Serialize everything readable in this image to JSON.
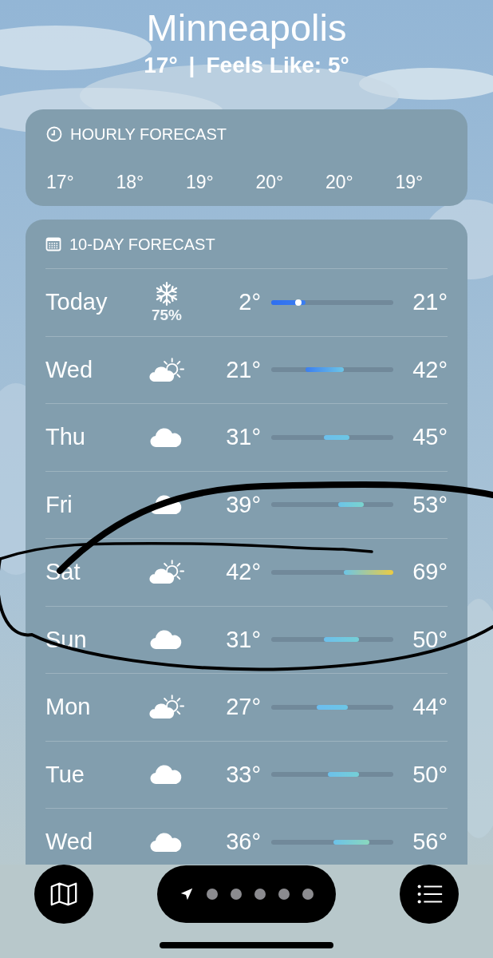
{
  "location": {
    "city": "Minneapolis",
    "current_temp": "17°",
    "separator": "|",
    "feels_like": "Feels Like: 5°"
  },
  "hourly": {
    "title": "HOURLY FORECAST",
    "temps": [
      "17°",
      "18°",
      "19°",
      "20°",
      "20°",
      "19°"
    ]
  },
  "daily": {
    "title": "10-DAY FORECAST",
    "days": [
      {
        "day": "Today",
        "kind": "snow",
        "precip": "75%",
        "low": "2°",
        "high": "21°",
        "show_current": true
      },
      {
        "day": "Wed",
        "kind": "partly_cloudy",
        "low": "21°",
        "high": "42°",
        "show_current": false
      },
      {
        "day": "Thu",
        "kind": "cloudy",
        "low": "31°",
        "high": "45°",
        "show_current": false
      },
      {
        "day": "Fri",
        "kind": "cloudy",
        "low": "39°",
        "high": "53°",
        "show_current": false
      },
      {
        "day": "Sat",
        "kind": "partly_cloudy",
        "low": "42°",
        "high": "69°",
        "show_current": false
      },
      {
        "day": "Sun",
        "kind": "cloudy",
        "low": "31°",
        "high": "50°",
        "show_current": false
      },
      {
        "day": "Mon",
        "kind": "partly_cloudy",
        "low": "27°",
        "high": "44°",
        "show_current": false
      },
      {
        "day": "Tue",
        "kind": "cloudy",
        "low": "33°",
        "high": "50°",
        "show_current": false
      },
      {
        "day": "Wed",
        "kind": "cloudy",
        "low": "36°",
        "high": "56°",
        "show_current": false
      }
    ]
  },
  "pages": [
    {
      "kind": "location",
      "selected": true
    },
    {
      "kind": "dot",
      "selected": false
    },
    {
      "kind": "dot",
      "selected": false
    },
    {
      "kind": "dot",
      "selected": false
    },
    {
      "kind": "dot",
      "selected": false
    },
    {
      "kind": "dot",
      "selected": false
    }
  ],
  "annotation": {
    "kind": "ellipse"
  }
}
